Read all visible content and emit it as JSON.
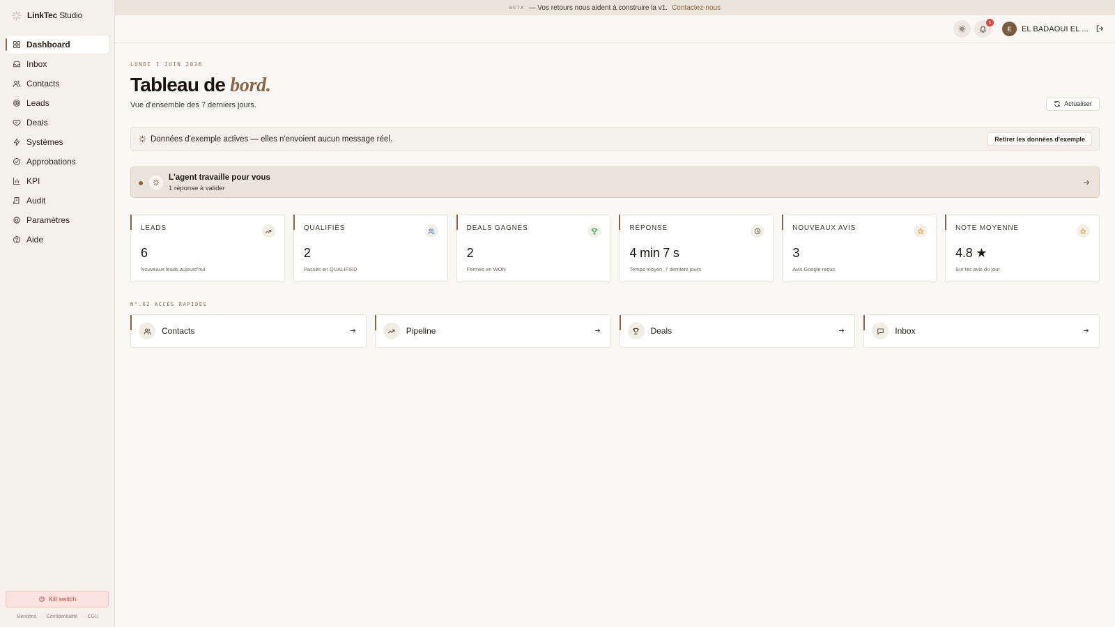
{
  "brand": {
    "name_bold": "LinkTec",
    "name_light": " Studio"
  },
  "nav": [
    {
      "label": "Dashboard",
      "icon": "dashboard-icon",
      "active": true
    },
    {
      "label": "Inbox",
      "icon": "inbox-icon"
    },
    {
      "label": "Contacts",
      "icon": "users-icon"
    },
    {
      "label": "Leads",
      "icon": "target-icon"
    },
    {
      "label": "Deals",
      "icon": "handshake-icon"
    },
    {
      "label": "Systèmes",
      "icon": "bolt-icon"
    },
    {
      "label": "Approbations",
      "icon": "check-circle-icon"
    },
    {
      "label": "KPI",
      "icon": "bar-chart-icon"
    },
    {
      "label": "Audit",
      "icon": "scroll-icon"
    },
    {
      "label": "Paramètres",
      "icon": "gear-icon"
    },
    {
      "label": "Aide",
      "icon": "help-circle-icon"
    }
  ],
  "kill_switch": "Kill switch",
  "legal": [
    "Mentions",
    "Confidentialité",
    "CGU"
  ],
  "beta": {
    "tag": "BETA",
    "text": "— Vos retours nous aident à construire la v1.",
    "link": "Contactez-nous"
  },
  "header": {
    "notifications_count": "1",
    "avatar_initial": "E",
    "user_name": "EL BADAOUI EL ..."
  },
  "page": {
    "date": "LUNDI 1 JUIN 2026",
    "title_main": "Tableau de ",
    "title_accent": "bord.",
    "subtitle": "Vue d'ensemble des 7 derniers jours.",
    "refresh": "Actualiser"
  },
  "notice": {
    "text": "Données d'exemple actives — elles n'envoient aucun message réel.",
    "button": "Retirer les données d'exemple"
  },
  "agent": {
    "title": "L'agent travaille pour vous",
    "subtitle": "1 réponse à valider"
  },
  "kpis": [
    {
      "label": "LEADS",
      "value": "6",
      "hint": "Nouveaux leads aujourd'hui",
      "icon": "trend-up-icon",
      "color": "#5a5047"
    },
    {
      "label": "QUALIFIÉS",
      "value": "2",
      "hint": "Passés en QUALIFIED",
      "icon": "users-icon",
      "color": "#4a90d9"
    },
    {
      "label": "DEALS GAGNÉS",
      "value": "2",
      "hint": "Fermés en WON",
      "icon": "trophy-icon",
      "color": "#2e9e52"
    },
    {
      "label": "RÉPONSE",
      "value": "4 min 7 s",
      "hint": "Temps moyen, 7 derniers jours",
      "icon": "clock-icon",
      "color": "#5a5047"
    },
    {
      "label": "NOUVEAUX AVIS",
      "value": "3",
      "hint": "Avis Google reçus",
      "icon": "star-icon",
      "color": "#e0a030"
    },
    {
      "label": "NOTE MOYENNE",
      "value": "4.8 ★",
      "hint": "Sur les avis du jour",
      "icon": "star-icon",
      "color": "#e0a030"
    }
  ],
  "quick_section": "N°.02 ACCÈS RAPIDES",
  "quick": [
    {
      "label": "Contacts",
      "icon": "users-icon"
    },
    {
      "label": "Pipeline",
      "icon": "trend-up-icon"
    },
    {
      "label": "Deals",
      "icon": "trophy-icon"
    },
    {
      "label": "Inbox",
      "icon": "message-icon"
    }
  ]
}
